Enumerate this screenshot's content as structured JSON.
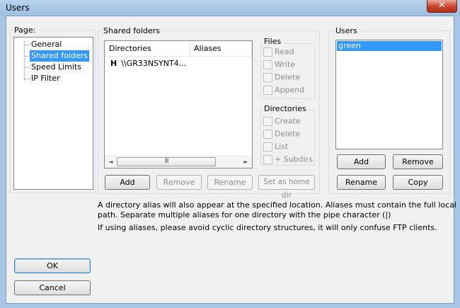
{
  "window": {
    "title": "Users",
    "close_glyph": "✕"
  },
  "page_group": {
    "label": "Page:",
    "items": [
      "General",
      "Shared folders",
      "Speed Limits",
      "IP Filter"
    ],
    "selected": 1
  },
  "shared_folders": {
    "label": "Shared folders",
    "columns": {
      "directories": "Directories",
      "aliases": "Aliases"
    },
    "rows": [
      {
        "flag": "H",
        "directory": "\\\\GR33NSYNT4..."
      }
    ],
    "scroll": {
      "left": "◄",
      "thumb": "III",
      "right": "►"
    },
    "buttons": {
      "add": "Add",
      "remove": "Remove",
      "rename": "Rename",
      "set_home": "Set as home dir"
    }
  },
  "files_group": {
    "label": "Files",
    "options": [
      "Read",
      "Write",
      "Delete",
      "Append"
    ]
  },
  "dirs_group": {
    "label": "Directories",
    "options": [
      "Create",
      "Delete",
      "List",
      "+ Subdirs"
    ]
  },
  "users_group": {
    "label": "Users",
    "items": [
      "green"
    ],
    "buttons": {
      "add": "Add",
      "remove": "Remove",
      "rename": "Rename",
      "copy": "Copy"
    }
  },
  "info": {
    "line1": "A directory alias will also appear at the specified location. Aliases must contain the full local",
    "line2": "path. Separate multiple aliases for one directory with the pipe character (|)",
    "line3": "If using aliases, please avoid cyclic directory structures, it will only confuse FTP clients."
  },
  "dialog_buttons": {
    "ok": "OK",
    "cancel": "Cancel"
  }
}
